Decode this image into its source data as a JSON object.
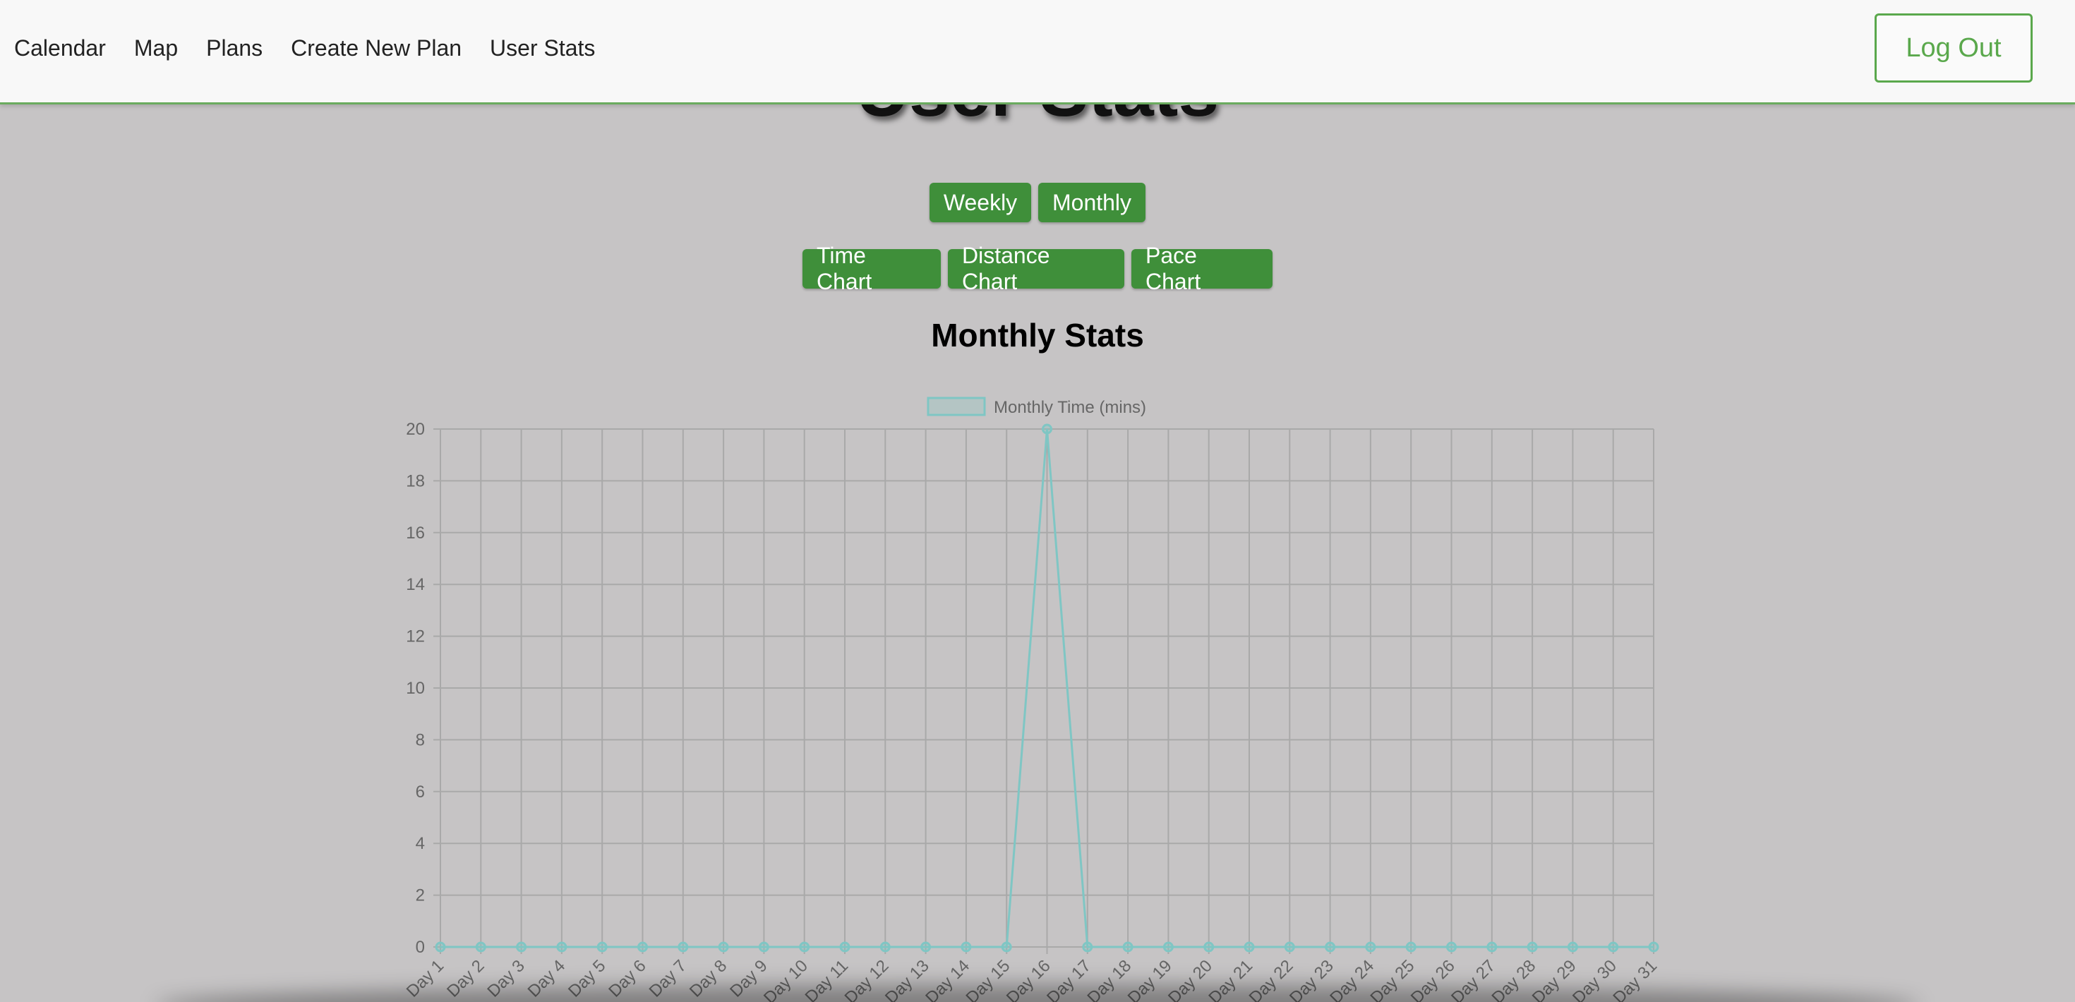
{
  "nav": {
    "links": [
      "Calendar",
      "Map",
      "Plans",
      "Create New Plan",
      "User Stats"
    ],
    "logout_label": "Log Out"
  },
  "page": {
    "title": "User Stats",
    "period_buttons": [
      "Weekly",
      "Monthly"
    ],
    "chart_buttons": [
      "Time Chart",
      "Distance Chart",
      "Pace Chart"
    ],
    "section_heading": "Monthly Stats"
  },
  "colors": {
    "accent": "#3f8f3a",
    "line": "#7fc6c4",
    "grid": "#a9a9a9",
    "background": "#c6c4c5"
  },
  "chart_data": {
    "type": "line",
    "categories": [
      "Day 1",
      "Day 2",
      "Day 3",
      "Day 4",
      "Day 5",
      "Day 6",
      "Day 7",
      "Day 8",
      "Day 9",
      "Day 10",
      "Day 11",
      "Day 12",
      "Day 13",
      "Day 14",
      "Day 15",
      "Day 16",
      "Day 17",
      "Day 18",
      "Day 19",
      "Day 20",
      "Day 21",
      "Day 22",
      "Day 23",
      "Day 24",
      "Day 25",
      "Day 26",
      "Day 27",
      "Day 28",
      "Day 29",
      "Day 30",
      "Day 31"
    ],
    "series": [
      {
        "name": "Monthly Time (mins)",
        "values": [
          0,
          0,
          0,
          0,
          0,
          0,
          0,
          0,
          0,
          0,
          0,
          0,
          0,
          0,
          0,
          20,
          0,
          0,
          0,
          0,
          0,
          0,
          0,
          0,
          0,
          0,
          0,
          0,
          0,
          0,
          0
        ]
      }
    ],
    "ylim": [
      0,
      20
    ],
    "yticks": [
      0,
      2,
      4,
      6,
      8,
      10,
      12,
      14,
      16,
      18,
      20
    ],
    "grid": true,
    "legend_position": "top"
  }
}
